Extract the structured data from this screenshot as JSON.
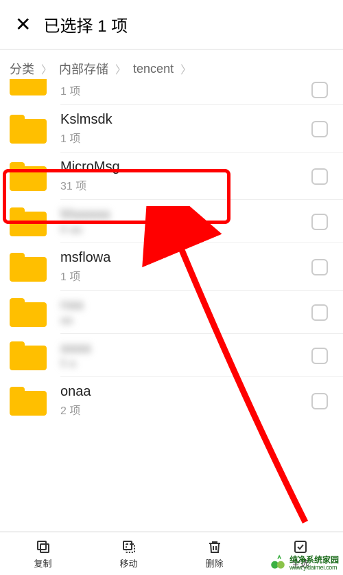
{
  "header": {
    "title": "已选择 1 项"
  },
  "breadcrumb": {
    "items": [
      "分类",
      "内部存储",
      "tencent"
    ]
  },
  "folders": [
    {
      "name": "",
      "sub": "1 项",
      "blur": false
    },
    {
      "name": "Kslmsdk",
      "sub": "1 项",
      "blur": false
    },
    {
      "name": "MicroMsg",
      "sub": "31 项",
      "blur": false
    },
    {
      "name": "Maaaaa",
      "sub": "6  aa",
      "blur": true
    },
    {
      "name": "msflowa",
      "sub": "1 项",
      "blur": false
    },
    {
      "name": "naa",
      "sub": "  aa",
      "blur": true
    },
    {
      "name": "aaaa",
      "sub": "5  a",
      "blur": true
    },
    {
      "name": "onaa",
      "sub": "2 项",
      "blur": false
    }
  ],
  "toolbar": {
    "copy": "复制",
    "move": "移动",
    "delete": "删除",
    "select_all": "全选"
  },
  "watermark": {
    "line1": "纯净系统家园",
    "line2": "www.yidaimei.com"
  }
}
